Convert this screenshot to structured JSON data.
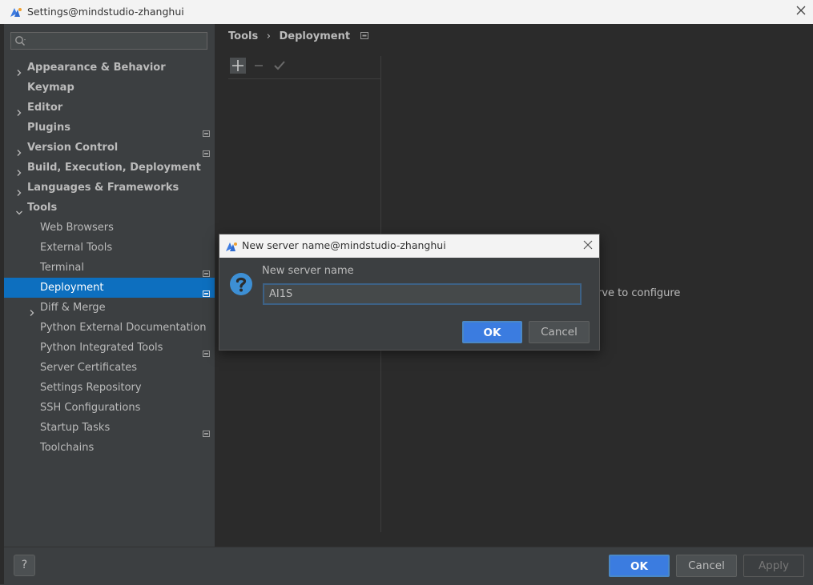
{
  "window": {
    "title": "Settings@mindstudio-zhanghui",
    "close_glyph": "✕"
  },
  "sidebar": {
    "search_placeholder": "",
    "items": [
      {
        "label": "Appearance & Behavior",
        "level": 0,
        "expandable": true,
        "expanded": false,
        "bold": true
      },
      {
        "label": "Keymap",
        "level": 0,
        "expandable": false,
        "bold": true
      },
      {
        "label": "Editor",
        "level": 0,
        "expandable": true,
        "expanded": false,
        "bold": true
      },
      {
        "label": "Plugins",
        "level": 0,
        "expandable": false,
        "bold": true,
        "project": true
      },
      {
        "label": "Version Control",
        "level": 0,
        "expandable": true,
        "expanded": false,
        "bold": true,
        "project": true
      },
      {
        "label": "Build, Execution, Deployment",
        "level": 0,
        "expandable": true,
        "expanded": false,
        "bold": true
      },
      {
        "label": "Languages & Frameworks",
        "level": 0,
        "expandable": true,
        "expanded": false,
        "bold": true
      },
      {
        "label": "Tools",
        "level": 0,
        "expandable": true,
        "expanded": true,
        "bold": true
      },
      {
        "label": "Web Browsers",
        "level": 1,
        "expandable": false
      },
      {
        "label": "External Tools",
        "level": 1,
        "expandable": false
      },
      {
        "label": "Terminal",
        "level": 1,
        "expandable": false,
        "project": true
      },
      {
        "label": "Deployment",
        "level": 1,
        "expandable": false,
        "project": true,
        "selected": true
      },
      {
        "label": "Diff & Merge",
        "level": 1,
        "expandable": true,
        "expanded": false
      },
      {
        "label": "Python External Documentation",
        "level": 1,
        "expandable": false
      },
      {
        "label": "Python Integrated Tools",
        "level": 1,
        "expandable": false,
        "project": true
      },
      {
        "label": "Server Certificates",
        "level": 1,
        "expandable": false
      },
      {
        "label": "Settings Repository",
        "level": 1,
        "expandable": false
      },
      {
        "label": "SSH Configurations",
        "level": 1,
        "expandable": false
      },
      {
        "label": "Startup Tasks",
        "level": 1,
        "expandable": false,
        "project": true
      },
      {
        "label": "Toolchains",
        "level": 1,
        "expandable": false
      }
    ]
  },
  "breadcrumb": {
    "parent": "Tools",
    "separator": "›",
    "current": "Deployment"
  },
  "main": {
    "hint_text": "erve to configure"
  },
  "footer": {
    "help": "?",
    "ok": "OK",
    "cancel": "Cancel",
    "apply": "Apply"
  },
  "dialog": {
    "title": "New server name@mindstudio-zhanghui",
    "close_glyph": "✕",
    "label": "New server name",
    "input_value": "AI1S",
    "ok": "OK",
    "cancel": "Cancel"
  },
  "colors": {
    "selection": "#0d6fbf",
    "primary_button": "#3b7ce0",
    "question_icon": "#3d8fd4"
  }
}
